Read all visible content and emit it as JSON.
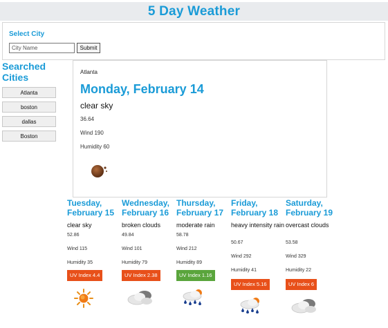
{
  "header": {
    "title": "5 Day Weather"
  },
  "search": {
    "label": "Select City",
    "placeholder": "City Name",
    "submit_label": "Submit"
  },
  "history": {
    "title": "Searched Cities",
    "items": [
      "Atlanta",
      "boston",
      "dallas",
      "Boston"
    ]
  },
  "current": {
    "city": "Atlanta",
    "date": "Monday, February 14",
    "description": "clear sky",
    "temp": "36.64",
    "wind": "Wind 190",
    "humidity": "Humidity 60",
    "icon": "clear-night-icon"
  },
  "forecast": [
    {
      "date": "Tuesday, February 15",
      "description": "clear sky",
      "temp": "52.86",
      "wind": "Wind 115",
      "humidity": "Humidity 35",
      "uv": "UV Index 4.4",
      "uv_color": "#e8501a",
      "icon": "sun-icon"
    },
    {
      "date": "Wednesday, February 16",
      "description": "broken clouds",
      "temp": "49.84",
      "wind": "Wind 101",
      "humidity": "Humidity 79",
      "uv": "UV Index 2.38",
      "uv_color": "#e8501a",
      "icon": "cloud-icon"
    },
    {
      "date": "Thursday, February 17",
      "description": "moderate rain",
      "temp": "58.78",
      "wind": "Wind 212",
      "humidity": "Humidity 89",
      "uv": "UV Index 1.16",
      "uv_color": "#5aa53c",
      "icon": "rain-icon"
    },
    {
      "date": "Friday, February 18",
      "description": "heavy intensity rain",
      "temp": "50.67",
      "wind": "Wind 292",
      "humidity": "Humidity 41",
      "uv": "UV Index 5.16",
      "uv_color": "#e8501a",
      "icon": "rain-icon"
    },
    {
      "date": "Saturday, February 19",
      "description": "overcast clouds",
      "temp": "53.58",
      "wind": "Wind 329",
      "humidity": "Humidity 22",
      "uv": "UV Index 6",
      "uv_color": "#e8501a",
      "icon": "cloud-icon"
    }
  ]
}
